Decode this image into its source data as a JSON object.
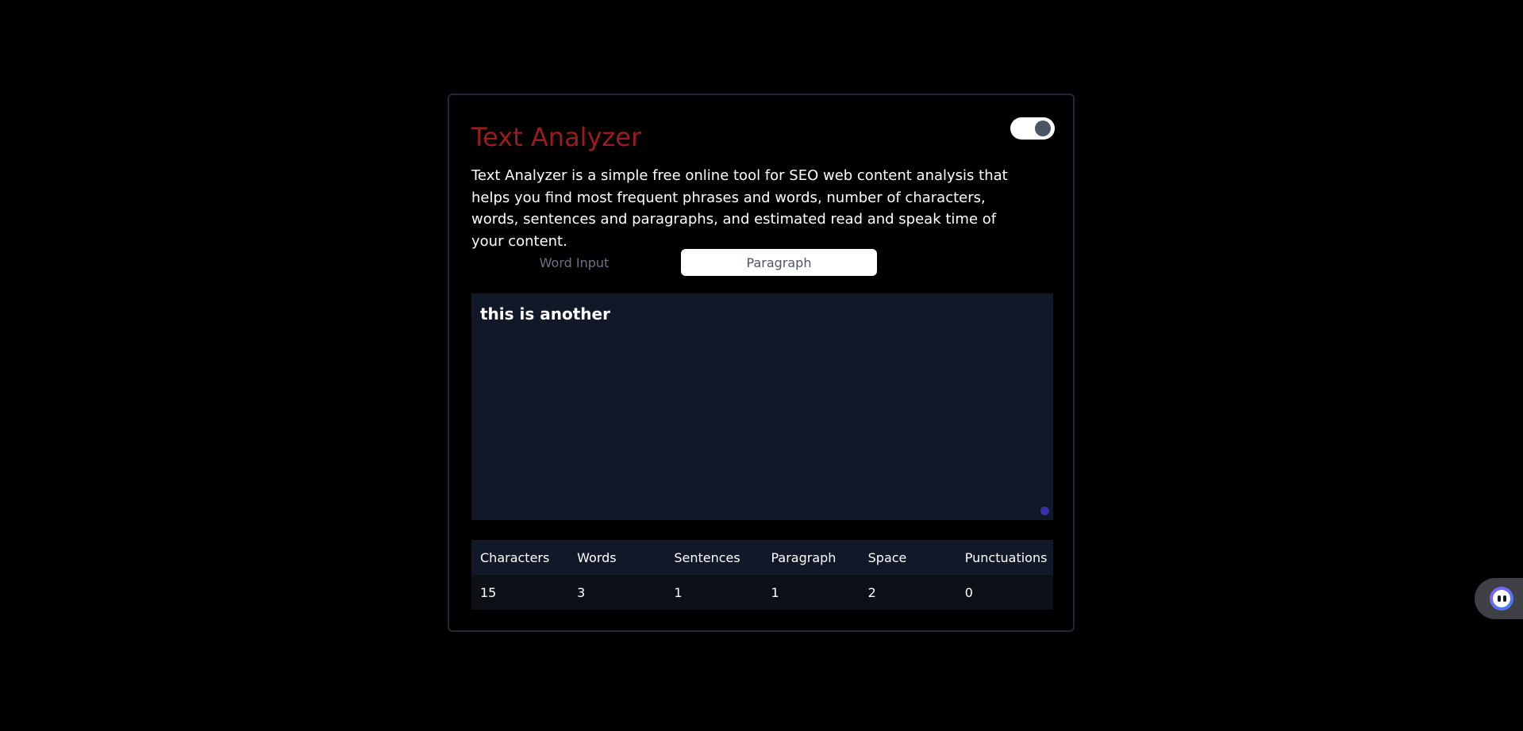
{
  "app": {
    "title": "Text Analyzer",
    "description": "Text Analyzer is a simple free online tool for SEO web content analysis that helps you find most frequent phrases and words, number of characters, words, sentences and paragraphs, and estimated read and speak time of your content.",
    "theme_toggle": {
      "state": "dark",
      "icon": "toggle-switch"
    },
    "title_color": "#9b1c1c"
  },
  "tabs": [
    {
      "label": "Word Input",
      "active": false
    },
    {
      "label": "Paragraph",
      "active": true
    }
  ],
  "editor": {
    "value": "this is another",
    "placeholder": ""
  },
  "stats": {
    "headers": [
      "Characters",
      "Words",
      "Sentences",
      "Paragraph",
      "Space",
      "Punctuations"
    ],
    "values": [
      "15",
      "3",
      "1",
      "1",
      "2",
      "0"
    ]
  },
  "side_widget": {
    "icon": "assistant-bot-icon"
  }
}
